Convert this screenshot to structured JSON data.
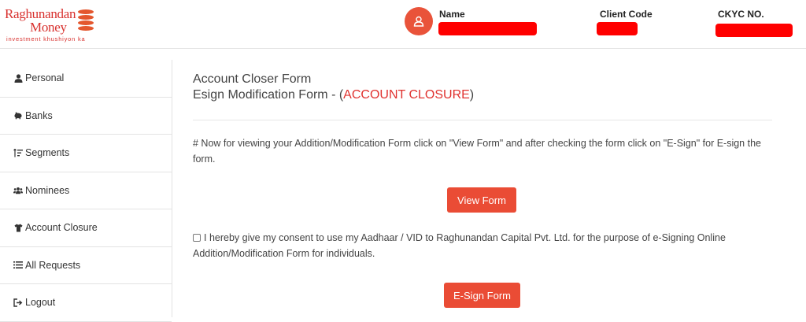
{
  "header": {
    "logo": {
      "line1": "Raghunandan",
      "line2": "Money",
      "tagline": "investment khushiyon ka"
    },
    "user_icon": "user-icon",
    "name_label": "Name",
    "client_code_label": "Client Code",
    "ckyc_label": "CKYC NO."
  },
  "sidebar": {
    "items": [
      {
        "label": "Personal",
        "icon": "user-icon"
      },
      {
        "label": "Banks",
        "icon": "piggy-bank-icon"
      },
      {
        "label": "Segments",
        "icon": "sort-list-icon"
      },
      {
        "label": "Nominees",
        "icon": "users-icon"
      },
      {
        "label": "Account Closure",
        "icon": "shirt-icon"
      },
      {
        "label": "All Requests",
        "icon": "list-icon"
      },
      {
        "label": "Logout",
        "icon": "sign-out-icon"
      }
    ]
  },
  "main": {
    "title1": "Account Closer Form",
    "title2_prefix": "Esign Modification Form - (",
    "title2_highlight": "ACCOUNT CLOSURE",
    "title2_suffix": ")",
    "note": "# Now for viewing your Addition/Modification Form click on \"View Form\" and after checking the form click on \"E-Sign\" for E-sign the form.",
    "view_form_button": "View Form",
    "consent_text": "I hereby give my consent to use my Aadhaar / VID to Raghunandan Capital Pvt. Ltd. for the purpose of e-Signing Online Addition/Modification Form for individuals.",
    "esign_button": "E-Sign Form"
  },
  "colors": {
    "accent": "#ea4c35",
    "highlight": "#e0322f",
    "redaction": "#ff0000"
  }
}
